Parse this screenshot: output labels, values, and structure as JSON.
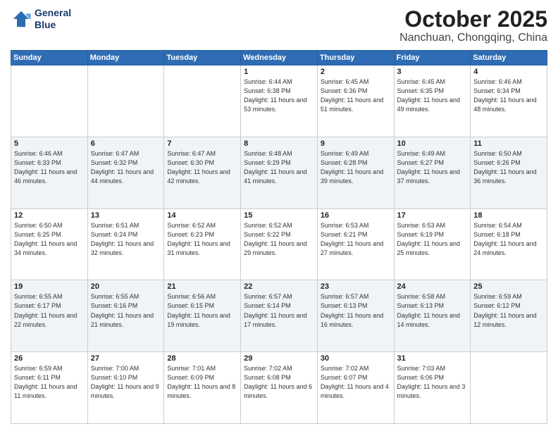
{
  "header": {
    "logo_line1": "General",
    "logo_line2": "Blue",
    "month": "October 2025",
    "location": "Nanchuan, Chongqing, China"
  },
  "days_of_week": [
    "Sunday",
    "Monday",
    "Tuesday",
    "Wednesday",
    "Thursday",
    "Friday",
    "Saturday"
  ],
  "weeks": [
    [
      {
        "day": "",
        "info": ""
      },
      {
        "day": "",
        "info": ""
      },
      {
        "day": "",
        "info": ""
      },
      {
        "day": "1",
        "info": "Sunrise: 6:44 AM\nSunset: 6:38 PM\nDaylight: 11 hours\nand 53 minutes."
      },
      {
        "day": "2",
        "info": "Sunrise: 6:45 AM\nSunset: 6:36 PM\nDaylight: 11 hours\nand 51 minutes."
      },
      {
        "day": "3",
        "info": "Sunrise: 6:45 AM\nSunset: 6:35 PM\nDaylight: 11 hours\nand 49 minutes."
      },
      {
        "day": "4",
        "info": "Sunrise: 6:46 AM\nSunset: 6:34 PM\nDaylight: 11 hours\nand 48 minutes."
      }
    ],
    [
      {
        "day": "5",
        "info": "Sunrise: 6:46 AM\nSunset: 6:33 PM\nDaylight: 11 hours\nand 46 minutes."
      },
      {
        "day": "6",
        "info": "Sunrise: 6:47 AM\nSunset: 6:32 PM\nDaylight: 11 hours\nand 44 minutes."
      },
      {
        "day": "7",
        "info": "Sunrise: 6:47 AM\nSunset: 6:30 PM\nDaylight: 11 hours\nand 42 minutes."
      },
      {
        "day": "8",
        "info": "Sunrise: 6:48 AM\nSunset: 6:29 PM\nDaylight: 11 hours\nand 41 minutes."
      },
      {
        "day": "9",
        "info": "Sunrise: 6:49 AM\nSunset: 6:28 PM\nDaylight: 11 hours\nand 39 minutes."
      },
      {
        "day": "10",
        "info": "Sunrise: 6:49 AM\nSunset: 6:27 PM\nDaylight: 11 hours\nand 37 minutes."
      },
      {
        "day": "11",
        "info": "Sunrise: 6:50 AM\nSunset: 6:26 PM\nDaylight: 11 hours\nand 36 minutes."
      }
    ],
    [
      {
        "day": "12",
        "info": "Sunrise: 6:50 AM\nSunset: 6:25 PM\nDaylight: 11 hours\nand 34 minutes."
      },
      {
        "day": "13",
        "info": "Sunrise: 6:51 AM\nSunset: 6:24 PM\nDaylight: 11 hours\nand 32 minutes."
      },
      {
        "day": "14",
        "info": "Sunrise: 6:52 AM\nSunset: 6:23 PM\nDaylight: 11 hours\nand 31 minutes."
      },
      {
        "day": "15",
        "info": "Sunrise: 6:52 AM\nSunset: 6:22 PM\nDaylight: 11 hours\nand 29 minutes."
      },
      {
        "day": "16",
        "info": "Sunrise: 6:53 AM\nSunset: 6:21 PM\nDaylight: 11 hours\nand 27 minutes."
      },
      {
        "day": "17",
        "info": "Sunrise: 6:53 AM\nSunset: 6:19 PM\nDaylight: 11 hours\nand 25 minutes."
      },
      {
        "day": "18",
        "info": "Sunrise: 6:54 AM\nSunset: 6:18 PM\nDaylight: 11 hours\nand 24 minutes."
      }
    ],
    [
      {
        "day": "19",
        "info": "Sunrise: 6:55 AM\nSunset: 6:17 PM\nDaylight: 11 hours\nand 22 minutes."
      },
      {
        "day": "20",
        "info": "Sunrise: 6:55 AM\nSunset: 6:16 PM\nDaylight: 11 hours\nand 21 minutes."
      },
      {
        "day": "21",
        "info": "Sunrise: 6:56 AM\nSunset: 6:15 PM\nDaylight: 11 hours\nand 19 minutes."
      },
      {
        "day": "22",
        "info": "Sunrise: 6:57 AM\nSunset: 6:14 PM\nDaylight: 11 hours\nand 17 minutes."
      },
      {
        "day": "23",
        "info": "Sunrise: 6:57 AM\nSunset: 6:13 PM\nDaylight: 11 hours\nand 16 minutes."
      },
      {
        "day": "24",
        "info": "Sunrise: 6:58 AM\nSunset: 6:13 PM\nDaylight: 11 hours\nand 14 minutes."
      },
      {
        "day": "25",
        "info": "Sunrise: 6:59 AM\nSunset: 6:12 PM\nDaylight: 11 hours\nand 12 minutes."
      }
    ],
    [
      {
        "day": "26",
        "info": "Sunrise: 6:59 AM\nSunset: 6:11 PM\nDaylight: 11 hours\nand 11 minutes."
      },
      {
        "day": "27",
        "info": "Sunrise: 7:00 AM\nSunset: 6:10 PM\nDaylight: 11 hours\nand 9 minutes."
      },
      {
        "day": "28",
        "info": "Sunrise: 7:01 AM\nSunset: 6:09 PM\nDaylight: 11 hours\nand 8 minutes."
      },
      {
        "day": "29",
        "info": "Sunrise: 7:02 AM\nSunset: 6:08 PM\nDaylight: 11 hours\nand 6 minutes."
      },
      {
        "day": "30",
        "info": "Sunrise: 7:02 AM\nSunset: 6:07 PM\nDaylight: 11 hours\nand 4 minutes."
      },
      {
        "day": "31",
        "info": "Sunrise: 7:03 AM\nSunset: 6:06 PM\nDaylight: 11 hours\nand 3 minutes."
      },
      {
        "day": "",
        "info": ""
      }
    ]
  ]
}
